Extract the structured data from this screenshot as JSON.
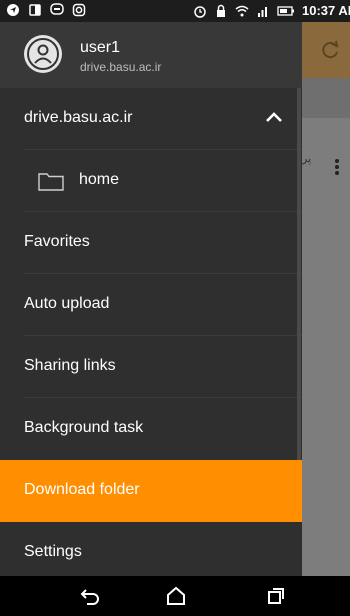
{
  "status_bar": {
    "time": "10:37 AM",
    "icons": [
      "location-icon",
      "tablet-icon",
      "chat-icon",
      "instagram-icon",
      "alarm-icon",
      "lock-icon",
      "wifi-icon",
      "signal-icon",
      "battery-icon"
    ]
  },
  "drawer": {
    "user": {
      "name": "user1",
      "host": "drive.basu.ac.ir"
    },
    "account_label": "drive.basu.ac.ir",
    "items": [
      {
        "label": "home"
      },
      {
        "label": "Favorites"
      },
      {
        "label": "Auto upload"
      },
      {
        "label": "Sharing links"
      },
      {
        "label": "Background task"
      },
      {
        "label": "Download folder"
      },
      {
        "label": "Settings"
      }
    ]
  },
  "background_app": {
    "partial_text": "پر"
  },
  "colors": {
    "accent": "#ff8f00",
    "drawer_bg": "#2f2f2f",
    "header_bg": "#383838"
  }
}
